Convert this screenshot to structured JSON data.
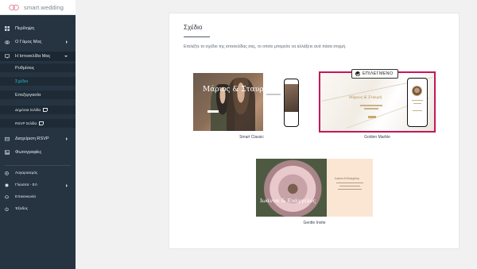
{
  "brand": {
    "name": "smart.wedding",
    "logo_icon": "rings-logo-icon"
  },
  "sidebar": {
    "items": [
      {
        "label": "Περίληψη",
        "icon": "dashboard-icon"
      },
      {
        "label": "Ο Γάμος Μας",
        "icon": "rings-icon"
      },
      {
        "label": "Η Ιστοσελίδα Μας",
        "icon": "monitor-icon"
      },
      {
        "label": "Διαχείριση RSVP",
        "icon": "rsvp-icon"
      },
      {
        "label": "Φωτογραφίες",
        "icon": "photos-icon"
      }
    ],
    "subitems": [
      {
        "label": "Ρυθμίσεις"
      },
      {
        "label": "Σχέδιο"
      },
      {
        "label": "Επεξεργασία"
      },
      {
        "label": "Δημόσια Σελίδα"
      },
      {
        "label": "RSVP Σελίδα"
      }
    ],
    "bottom": [
      {
        "label": "Λογαριασμός",
        "icon": "account-icon"
      },
      {
        "label": "Γλώσσα - ΕΛ",
        "icon": "globe-icon"
      },
      {
        "label": "Επικοινωνία",
        "icon": "chat-icon"
      },
      {
        "label": "Έξοδος",
        "icon": "power-icon"
      }
    ]
  },
  "main": {
    "title": "Σχέδιο",
    "hint": "Επιλέξτε το σχέδιο της ιστοσελίδας σας, το οποίο μπορείτε να αλλάξετε ανά πάσα στιγμή.",
    "selected_badge": "ΕΠΙΛΕΓΜΕΝΟ",
    "accent_color": "#c2185b",
    "designs": [
      {
        "label": "Smart Classic",
        "preview_text": "Μάριος & Σταυρή",
        "selected": false
      },
      {
        "label": "Golden Marble",
        "preview_text": "Μάριος & Σταυρή",
        "selected": true
      },
      {
        "label": "Gentle Invite",
        "preview_text": "Ιωάννα & Ευάγγελος",
        "preview_title": "Ιωάννα & Ευάγγελος",
        "selected": false
      }
    ]
  }
}
